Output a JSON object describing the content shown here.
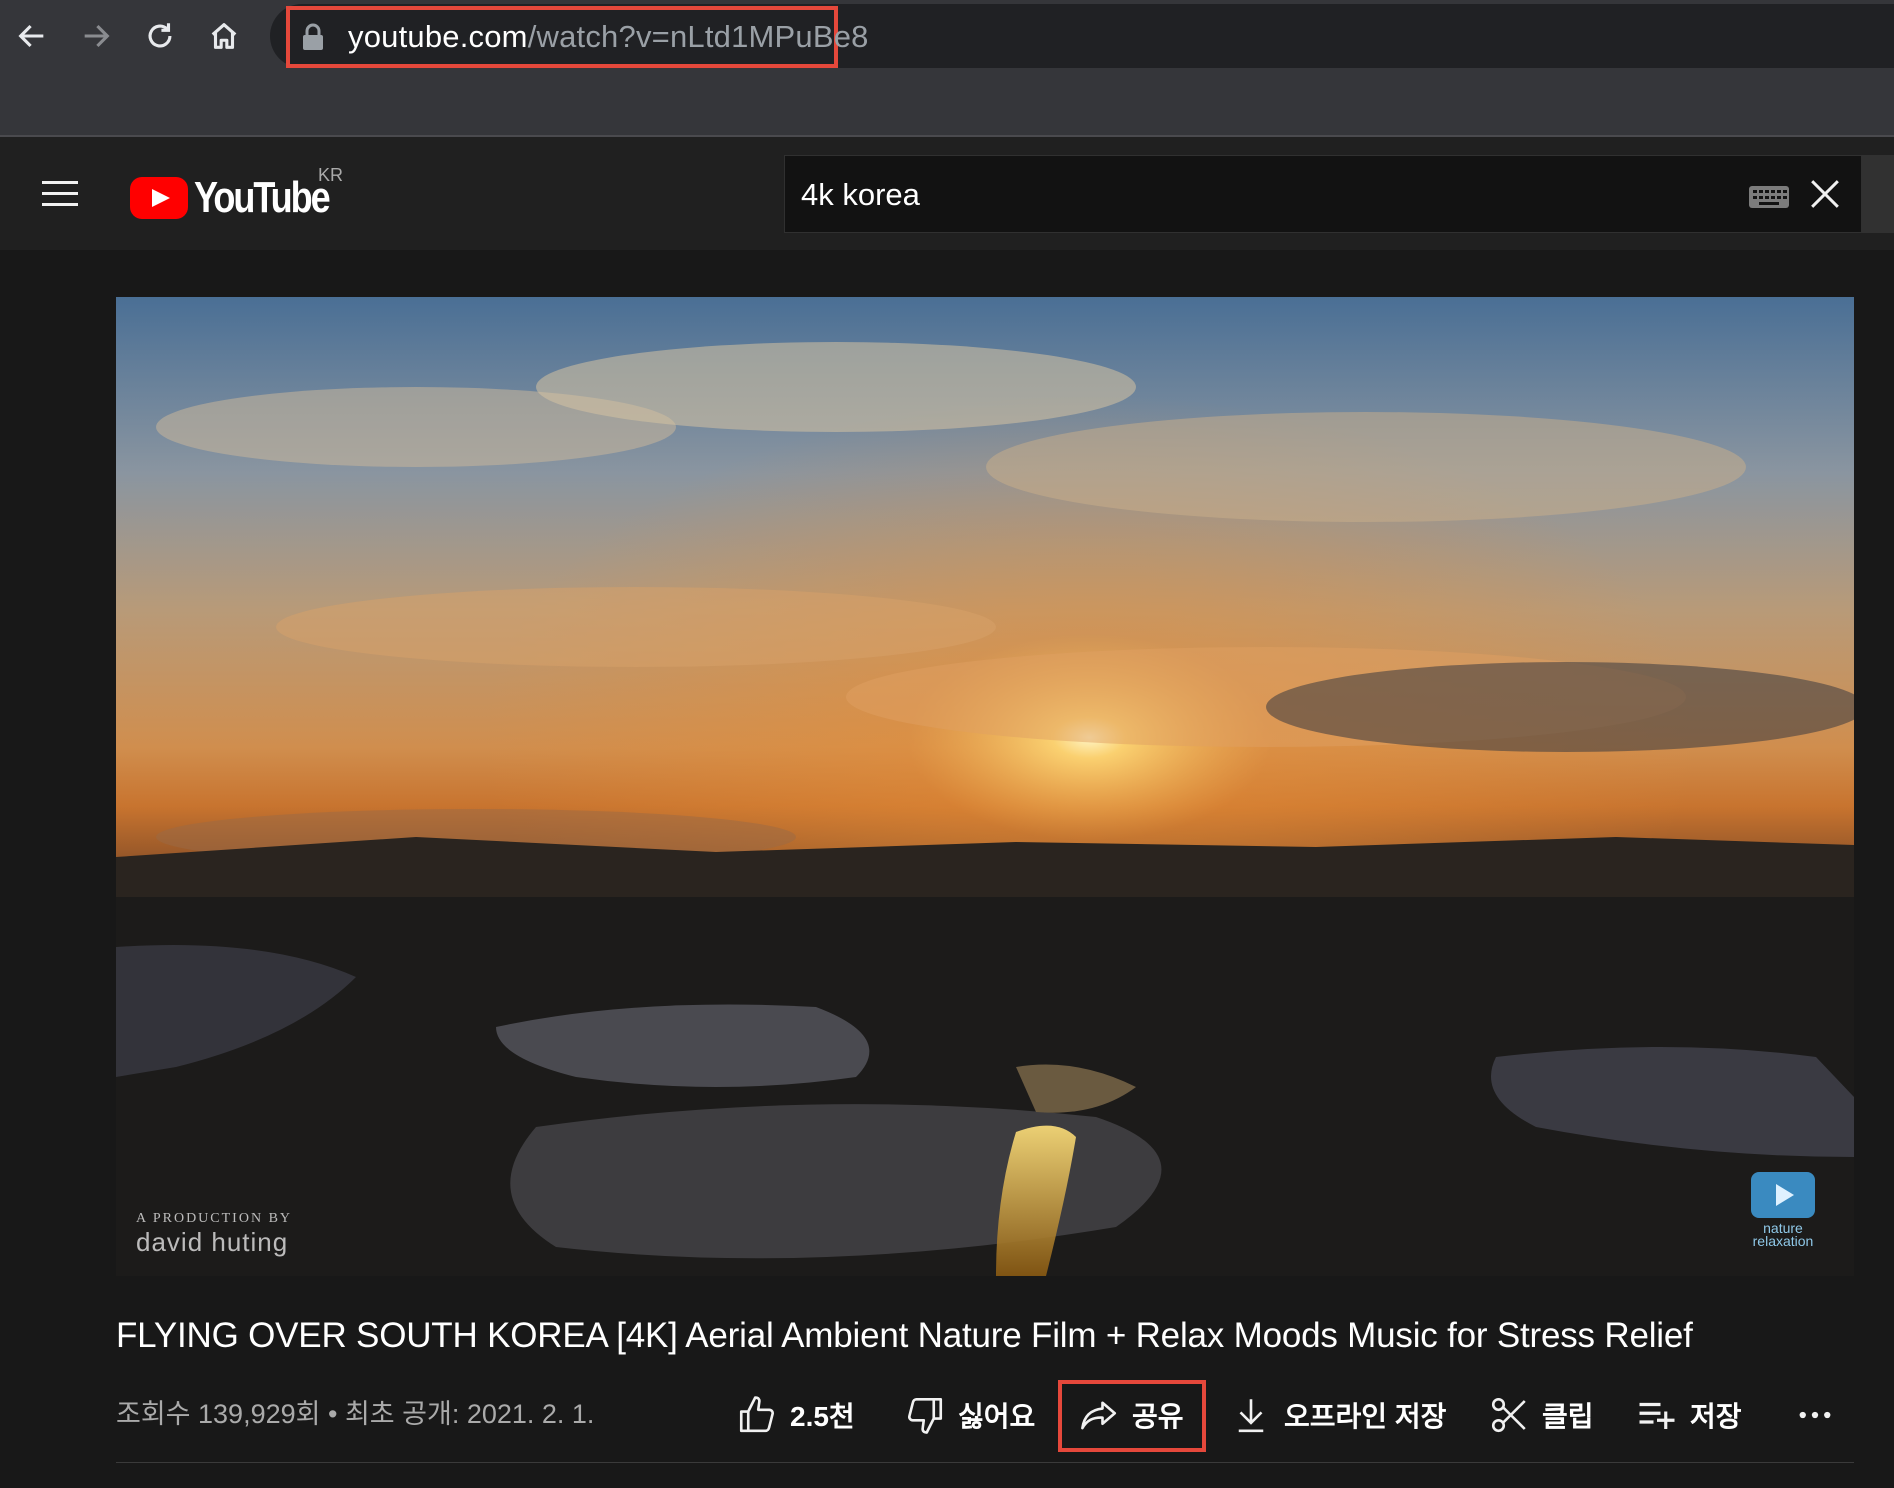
{
  "browser": {
    "url_host": "youtube.com",
    "url_path": "/watch?v=nLtd1MPuBe8",
    "icons": [
      "back-icon",
      "forward-icon",
      "reload-icon",
      "home-icon",
      "lock-icon"
    ]
  },
  "header": {
    "logo_text": "YouTube",
    "country_code": "KR",
    "search_value": "4k korea",
    "icons": [
      "menu-icon",
      "keyboard-icon",
      "close-icon"
    ]
  },
  "video": {
    "credit_line1": "A PRODUCTION BY",
    "credit_line2": "david huting",
    "channel_watermark_line1": "nature",
    "channel_watermark_line2": "relaxation"
  },
  "info": {
    "title": "FLYING OVER SOUTH KOREA [4K] Aerial Ambient Nature Film + Relax Moods Music for Stress Relief",
    "views": "조회수 139,929회",
    "separator": "•",
    "published": "최초 공개: 2021. 2. 1."
  },
  "actions": {
    "like": "2.5천",
    "dislike": "싫어요",
    "share": "공유",
    "download": "오프라인 저장",
    "clip": "클립",
    "save": "저장",
    "more": "..."
  },
  "colors": {
    "highlight": "#e5483b",
    "brand_red": "#ff0000",
    "page_bg": "#181818"
  }
}
